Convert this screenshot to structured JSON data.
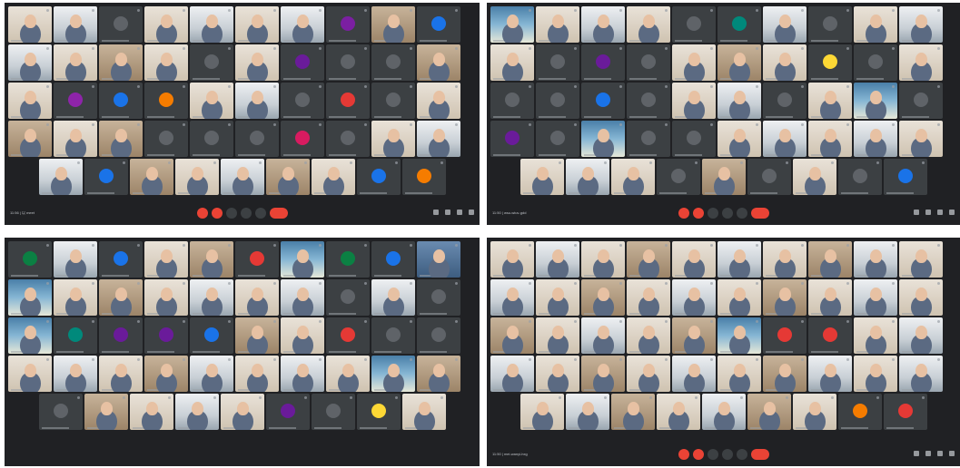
{
  "panels": [
    {
      "id": "top-left",
      "meeting_info": "11:56 | 以 meet",
      "tile_width": 48,
      "rows": [
        [
          "video:v5",
          "video:v2",
          "avatar:#5f6368",
          "video:v5",
          "video:v2",
          "video:v5",
          "video:v2",
          "avatar:#7b1fa2",
          "video:v3",
          "avatar:#1a73e8"
        ],
        [
          "video:v2",
          "video:v5",
          "video:v3",
          "video:v5",
          "avatar:#5f6368",
          "video:v5",
          "avatar:#6a1b9a",
          "avatar:#5f6368",
          "avatar:#5f6368",
          "video:v3"
        ],
        [
          "video:v5",
          "avatar:#8e24aa",
          "avatar:#1a73e8",
          "avatar:#f57c00",
          "video:v5",
          "video:v2",
          "avatar:#5f6368",
          "avatar:#e53935",
          "avatar:#5f6368",
          "video:v5"
        ],
        [
          "video:v3",
          "video:v5",
          "video:v3",
          "avatar:#5f6368",
          "avatar:#5f6368",
          "avatar:#5f6368",
          "avatar:#d81b60",
          "avatar:#5f6368",
          "video:v5",
          "video:v2"
        ],
        [
          "video:v2",
          "avatar:#1a73e8",
          "video:v3",
          "video:v5",
          "video:v2",
          "video:v3",
          "video:v5",
          "avatar:#1a73e8",
          "avatar:#f57c00"
        ]
      ]
    },
    {
      "id": "top-right",
      "meeting_info": "11:50 | wsu-wiuv-gdd",
      "tile_width": 48,
      "rows": [
        [
          "video:v6",
          "video:v5",
          "video:v2",
          "video:v5",
          "avatar:#5f6368",
          "avatar:#00897b",
          "video:v2",
          "avatar:#5f6368",
          "video:v5",
          "video:v2"
        ],
        [
          "video:v5",
          "avatar:#5f6368",
          "avatar:#6a1b9a",
          "avatar:#5f6368",
          "video:v5",
          "video:v3",
          "video:v5",
          "avatar:#fdd835",
          "avatar:#5f6368",
          "video:v5"
        ],
        [
          "avatar:#5f6368",
          "avatar:#5f6368",
          "avatar:#1a73e8",
          "avatar:#5f6368",
          "video:v5",
          "video:v2",
          "avatar:#5f6368",
          "video:v5",
          "video:v6",
          "avatar:#5f6368"
        ],
        [
          "avatar:#6a1b9a",
          "avatar:#5f6368",
          "video:v6",
          "avatar:#5f6368",
          "avatar:#5f6368",
          "video:v5",
          "video:v2",
          "video:v5",
          "video:v2",
          "video:v5"
        ],
        [
          "video:v5",
          "video:v2",
          "video:v5",
          "avatar:#5f6368",
          "video:v3",
          "avatar:#5f6368",
          "video:v5",
          "avatar:#5f6368",
          "avatar:#1a73e8"
        ]
      ]
    },
    {
      "id": "bottom-left",
      "meeting_info": "",
      "tile_width": 48,
      "rows": [
        [
          "avatar:#0b8043",
          "video:v2",
          "avatar:#1a73e8",
          "video:v5",
          "video:v3",
          "avatar:#e53935",
          "video:v6",
          "avatar:#0b8043",
          "avatar:#1a73e8",
          "video:v4"
        ],
        [
          "video:v6",
          "video:v5",
          "video:v3",
          "video:v5",
          "video:v2",
          "video:v5",
          "video:v2",
          "avatar:#5f6368",
          "video:v2",
          "avatar:#5f6368"
        ],
        [
          "video:v6",
          "avatar:#00897b",
          "avatar:#6a1b9a",
          "avatar:#6a1b9a",
          "avatar:#1a73e8",
          "video:v3",
          "video:v5",
          "avatar:#e53935",
          "avatar:#5f6368",
          "avatar:#5f6368"
        ],
        [
          "video:v5",
          "video:v2",
          "video:v5",
          "video:v3",
          "video:v2",
          "video:v5",
          "video:v2",
          "video:v5",
          "video:v6",
          "video:v3"
        ],
        [
          "avatar:#5f6368",
          "video:v3",
          "video:v5",
          "video:v2",
          "video:v5",
          "avatar:#6a1b9a",
          "avatar:#5f6368",
          "avatar:#fdd835",
          "video:v5"
        ]
      ]
    },
    {
      "id": "bottom-right",
      "meeting_info": "11:50 | mei-wanyi-hxg",
      "tile_width": 48,
      "rows": [
        [
          "video:v5",
          "video:v2",
          "video:v5",
          "video:v3",
          "video:v5",
          "video:v2",
          "video:v5",
          "video:v3",
          "video:v2",
          "video:v5"
        ],
        [
          "video:v2",
          "video:v5",
          "video:v3",
          "video:v5",
          "video:v2",
          "video:v5",
          "video:v3",
          "video:v5",
          "video:v2",
          "video:v5"
        ],
        [
          "video:v3",
          "video:v5",
          "video:v2",
          "video:v5",
          "video:v3",
          "video:v6",
          "avatar:#e53935",
          "avatar:#e53935",
          "video:v5",
          "video:v2"
        ],
        [
          "video:v2",
          "video:v5",
          "video:v3",
          "video:v5",
          "video:v2",
          "video:v5",
          "video:v3",
          "video:v2",
          "video:v5",
          "video:v2"
        ],
        [
          "video:v5",
          "video:v2",
          "video:v3",
          "video:v5",
          "video:v2",
          "video:v3",
          "video:v5",
          "avatar:#f57c00",
          "avatar:#e53935"
        ]
      ]
    }
  ],
  "accent_colors": {
    "background": "#202124",
    "tile": "#3c4043",
    "end_call": "#ea4335"
  },
  "icons": [
    "mic-icon",
    "camera-icon",
    "captions-icon",
    "present-icon",
    "more-icon",
    "end-call-icon",
    "info-icon",
    "people-icon",
    "chat-icon",
    "activities-icon"
  ]
}
